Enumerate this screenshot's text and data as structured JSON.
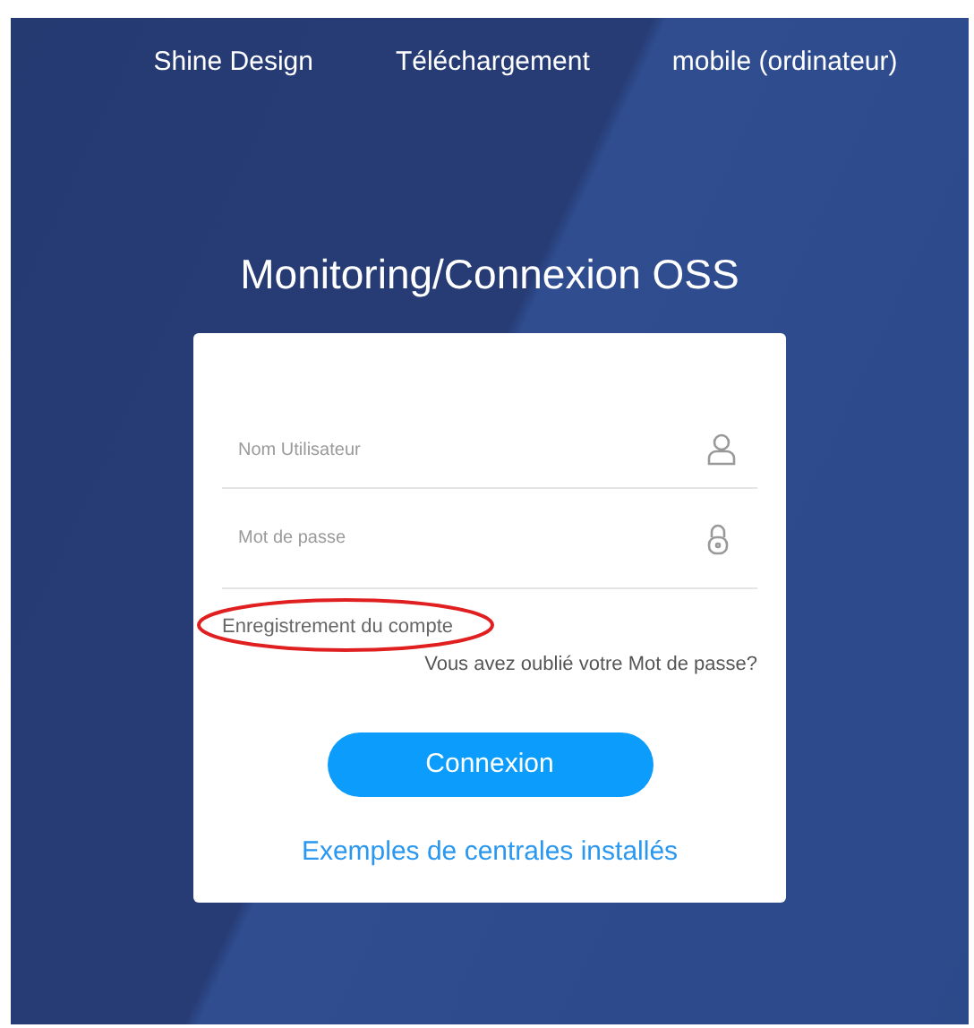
{
  "nav": [
    "Shine Design",
    "Téléchargement",
    "mobile (ordinateur)"
  ],
  "title": "Monitoring/Connexion OSS",
  "form": {
    "username": {
      "placeholder": "Nom Utilisateur"
    },
    "password": {
      "placeholder": "Mot de passe"
    },
    "register_link": "Enregistrement du compte",
    "register_highlighted": true,
    "forgot_link": "Vous avez oublié votre Mot de passe?",
    "submit": "Connexion",
    "examples_link": "Exemples de centrales installés"
  }
}
